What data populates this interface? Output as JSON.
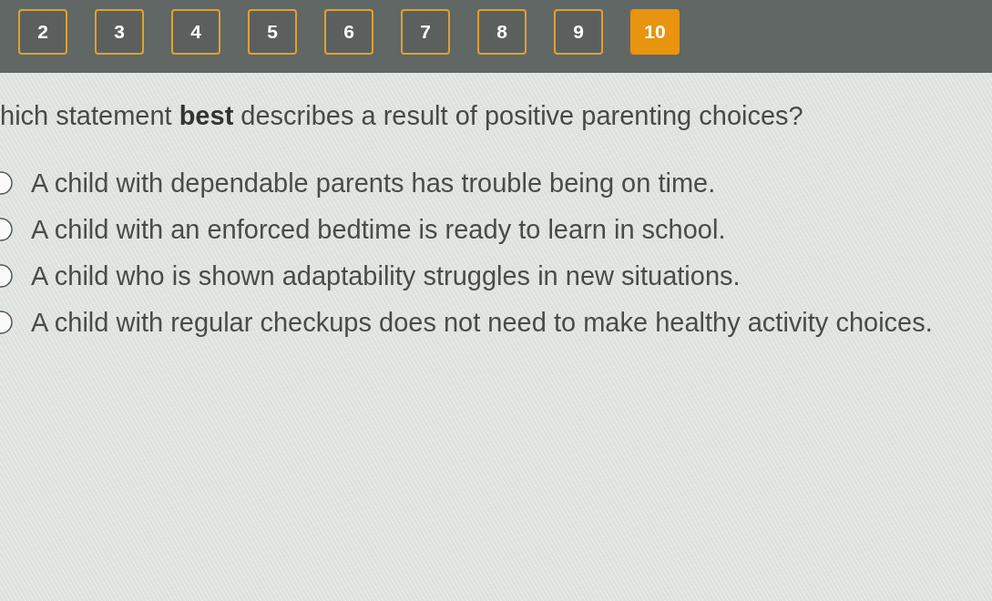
{
  "question_nav": [
    {
      "label": "2",
      "selected": false
    },
    {
      "label": "3",
      "selected": false
    },
    {
      "label": "4",
      "selected": false
    },
    {
      "label": "5",
      "selected": false
    },
    {
      "label": "6",
      "selected": false
    },
    {
      "label": "7",
      "selected": false
    },
    {
      "label": "8",
      "selected": false
    },
    {
      "label": "9",
      "selected": false
    },
    {
      "label": "10",
      "selected": true
    }
  ],
  "question": {
    "text": "hich statement **best** describes a result of positive parenting choices?"
  },
  "options": [
    {
      "text": "A child with dependable parents has trouble being on time.",
      "selected": false
    },
    {
      "text": "A child with an enforced bedtime is ready to learn in school.",
      "selected": false
    },
    {
      "text": "A child who is shown adaptability struggles in new situations.",
      "selected": false
    },
    {
      "text": "A child with regular checkups does not need to make healthy activity choices.",
      "selected": false
    }
  ]
}
